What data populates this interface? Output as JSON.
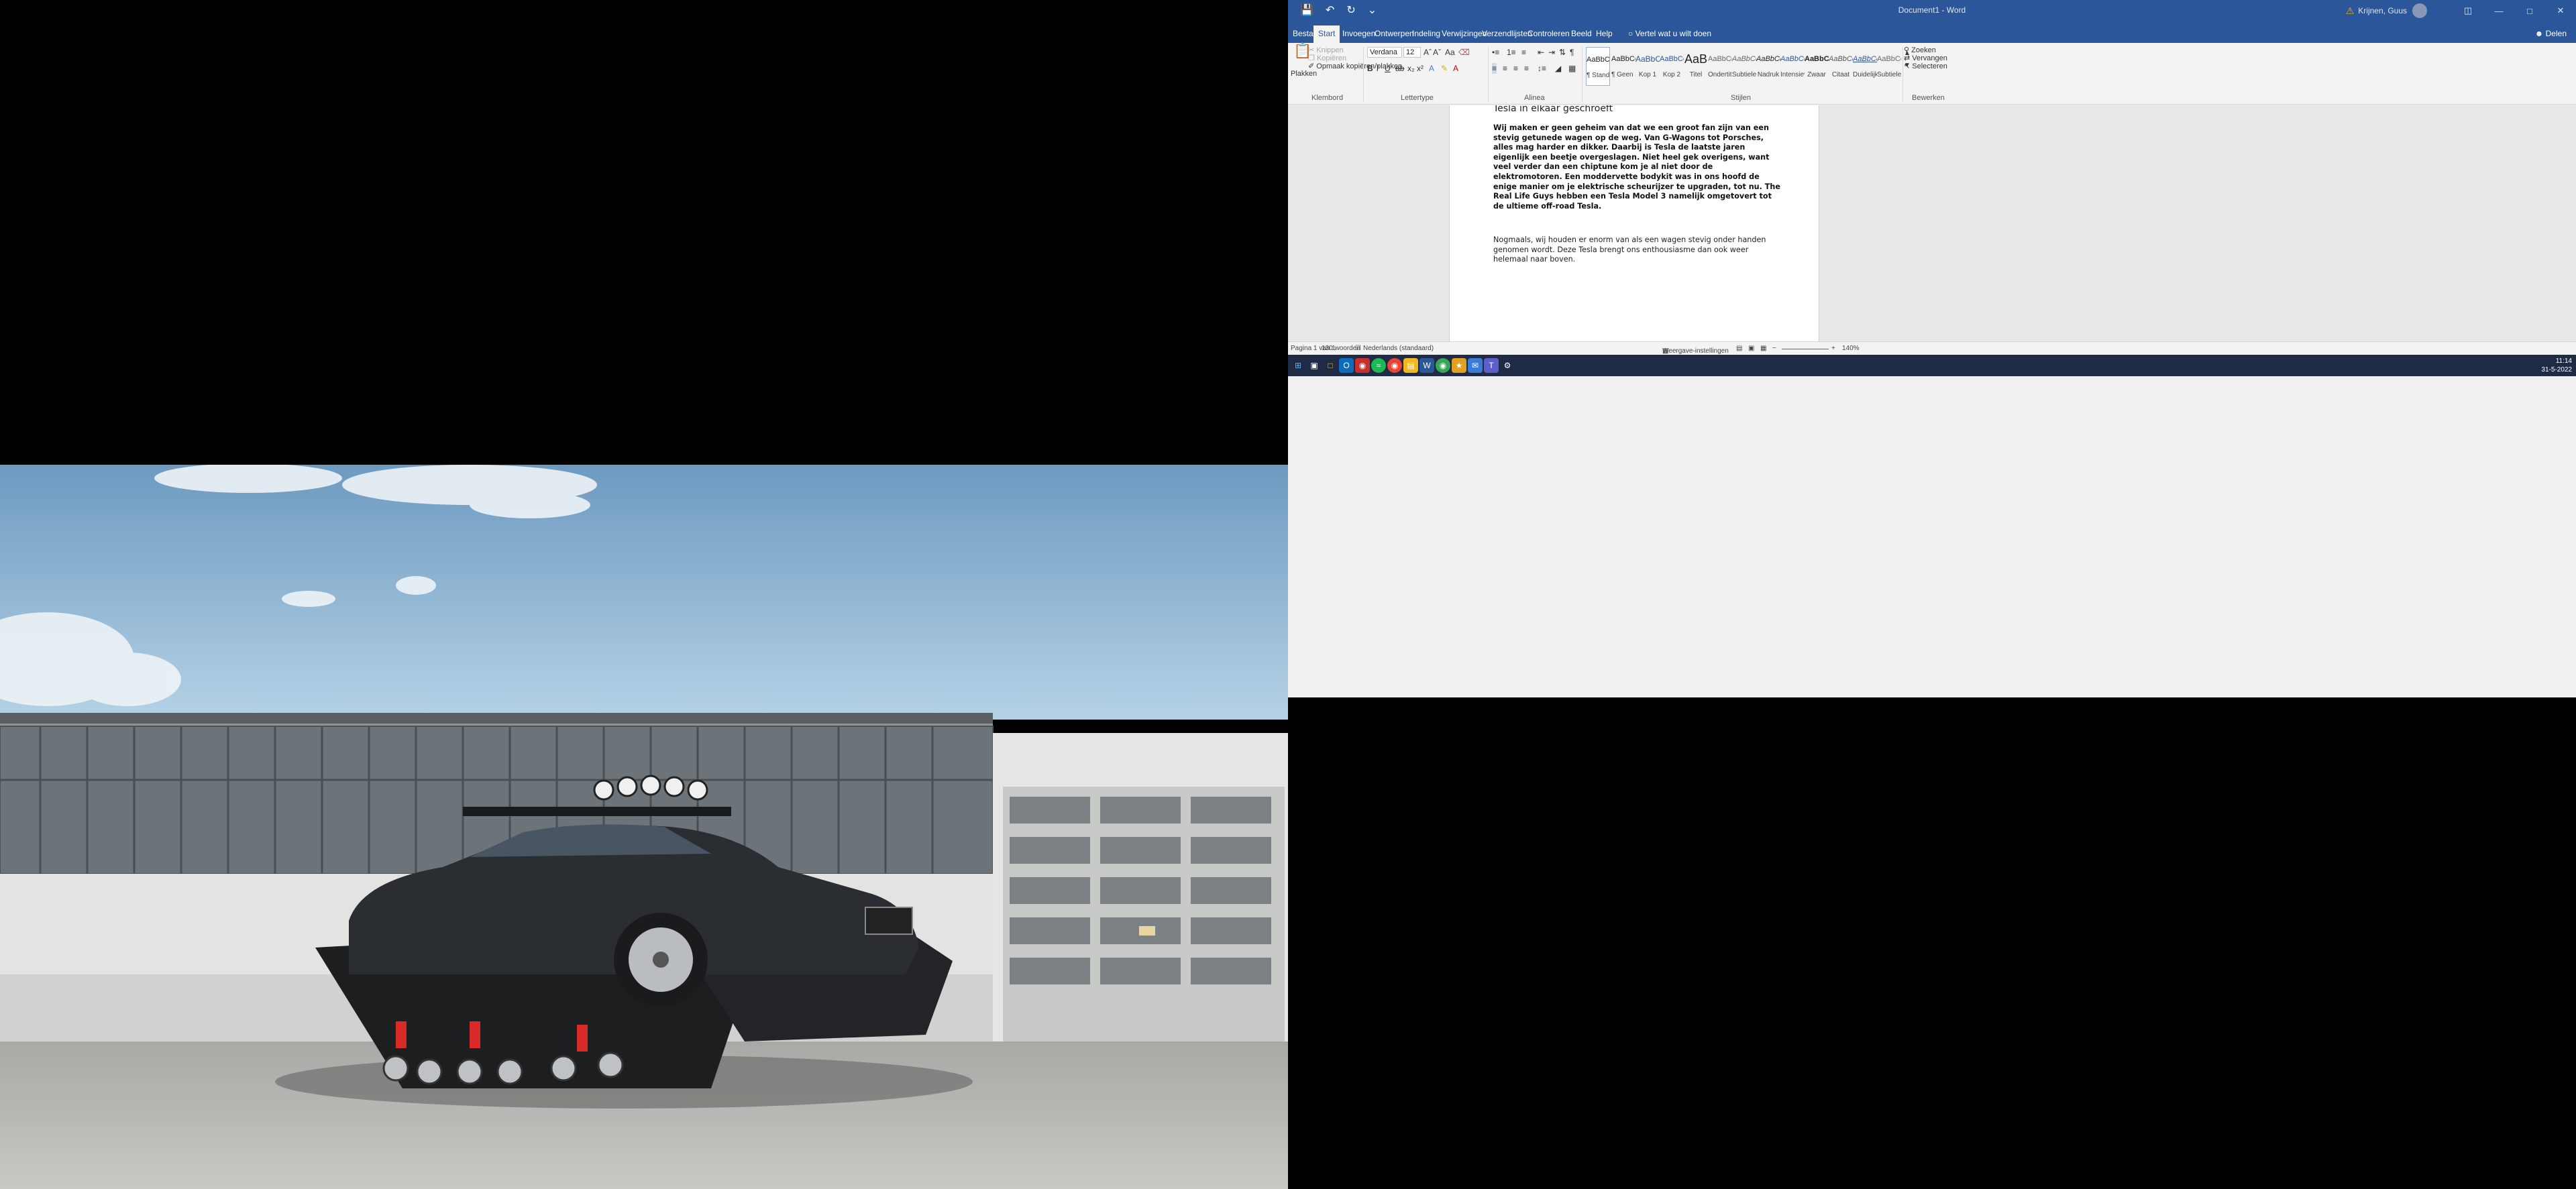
{
  "word": {
    "doc_title": "Document1 - Word",
    "user_name": "Krijnen, Guus",
    "quick_access": [
      "save-icon",
      "undo-icon",
      "redo-icon",
      "customize-icon"
    ],
    "tabs": [
      "Bestand",
      "Start",
      "Invoegen",
      "Ontwerpen",
      "Indeling",
      "Verwijzingen",
      "Verzendlijsten",
      "Controleren",
      "Beeld",
      "Help"
    ],
    "active_tab": "Start",
    "tell_me": "Vertel wat u wilt doen",
    "share": "Delen",
    "ribbon": {
      "paste": "Plakken",
      "cut": "Knippen",
      "copy": "Kopiëren",
      "format_painter": "Opmaak kopiëren/plakken",
      "group_clipboard": "Klembord",
      "font_name": "Verdana",
      "font_size": "12",
      "group_font": "Lettertype",
      "group_paragraph": "Alinea",
      "group_styles": "Stijlen",
      "group_edit": "Bewerken",
      "find": "Zoeken",
      "replace": "Vervangen",
      "select": "Selecteren",
      "styles": [
        {
          "preview": "AaBbCcDc",
          "name": "¶ Standaard"
        },
        {
          "preview": "AaBbCcDc",
          "name": "¶ Geen afs..."
        },
        {
          "preview": "AaBbCc",
          "name": "Kop 1"
        },
        {
          "preview": "AaBbCcC",
          "name": "Kop 2"
        },
        {
          "preview": "AaB",
          "name": "Titel"
        },
        {
          "preview": "AaBbCcC",
          "name": "Ondertitel"
        },
        {
          "preview": "AaBbCcDc",
          "name": "Subtiele b..."
        },
        {
          "preview": "AaBbCcDc",
          "name": "Nadruk"
        },
        {
          "preview": "AaBbCcDc",
          "name": "Intensieve..."
        },
        {
          "preview": "AaBbCcDc",
          "name": "Zwaar"
        },
        {
          "preview": "AaBbCcDc",
          "name": "Citaat"
        },
        {
          "preview": "AaBbCcDc",
          "name": "Duidelijk c..."
        },
        {
          "preview": "AaBbCcDc",
          "name": "Subtiele v..."
        }
      ]
    },
    "document": {
      "heading": "Tesla in elkaar geschroeft",
      "para_bold": "Wij maken er geen geheim van dat we een groot fan zijn van een stevig getunede wagen op de weg. Van G-Wagons tot Porsches, alles mag harder en dikker. Daarbij is Tesla de laatste jaren eigenlijk een beetje overgeslagen. Niet heel gek overigens, want veel verder dan een chiptune kom je al niet door de elektromotoren. Een moddervette bodykit was in ons hoofd de enige manier om je elektrische scheurijzer te upgraden, tot nu. The Real Life Guys hebben een Tesla Model 3 namelijk omgetovert tot de ultieme off-road Tesla.",
      "para": "Nogmaals, wij houden er enorm van als een wagen stevig onder handen genomen wordt. Deze Tesla brengt ons enthousiasme dan ook weer helemaal naar boven."
    },
    "status": {
      "page": "Pagina 1 van 1",
      "words": "130 woorden",
      "language": "Nederlands (standaard)",
      "display_settings": "Weergave-instellingen",
      "zoom": "140%"
    },
    "taskbar": {
      "time": "11:14",
      "date": "31-5-2022"
    }
  },
  "colors": {
    "word_blue": "#2b579a",
    "taskbar": "#1f2a44",
    "sky": "#9cc3de",
    "pavement": "#b9b8b4"
  }
}
